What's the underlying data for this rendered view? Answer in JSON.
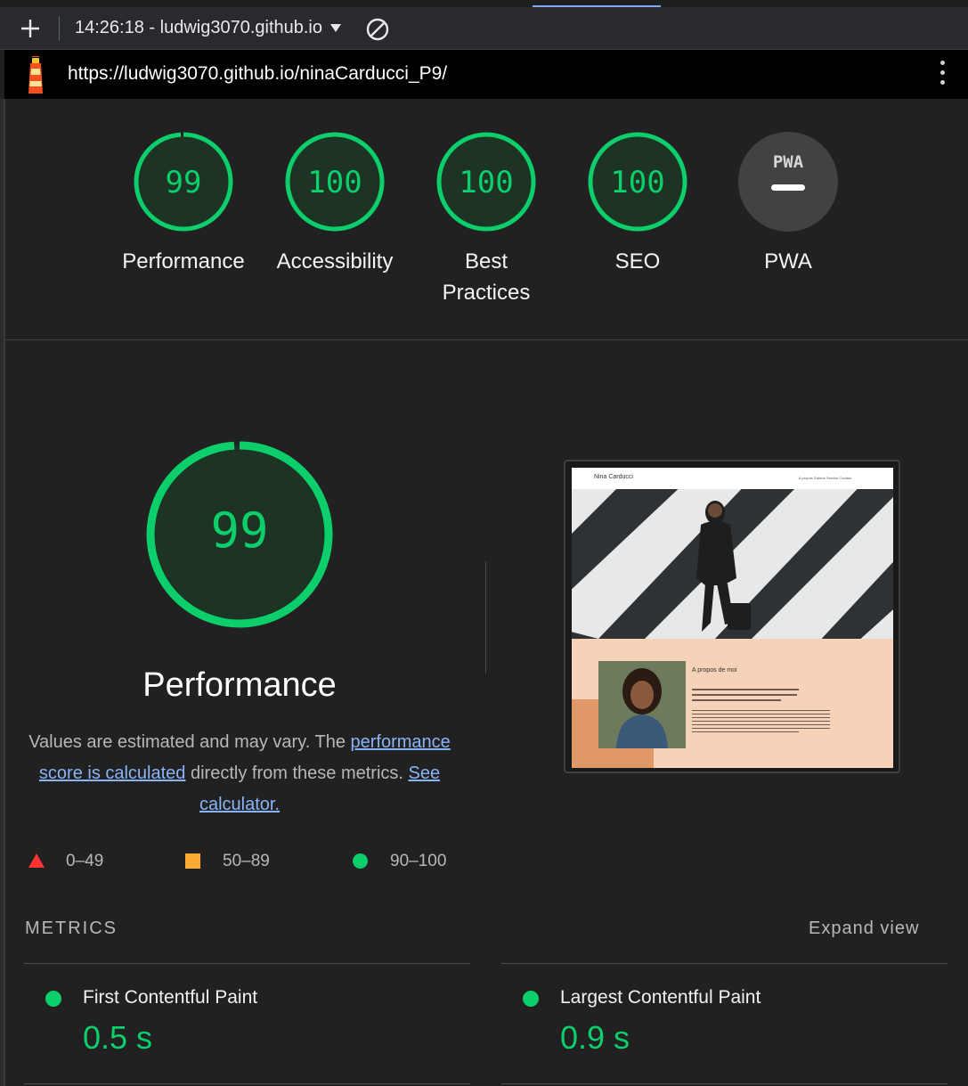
{
  "toolbar": {
    "report_label": "14:26:18 - ludwig3070.github.io",
    "new_report_icon": "plus-icon",
    "dropdown_icon": "caret-down-icon",
    "clear_icon": "block-icon"
  },
  "urlbar": {
    "url": "https://ludwig3070.github.io/ninaCarducci_P9/",
    "logo_icon": "lighthouse-icon",
    "menu_icon": "kebab-menu-icon"
  },
  "gauges": [
    {
      "score": "99",
      "value": 99,
      "label": "Performance"
    },
    {
      "score": "100",
      "value": 100,
      "label": "Accessibility"
    },
    {
      "score": "100",
      "value": 100,
      "label": "Best Practices"
    },
    {
      "score": "100",
      "value": 100,
      "label": "SEO"
    },
    {
      "score": "PWA",
      "value": null,
      "label": "PWA"
    }
  ],
  "performance": {
    "score": "99",
    "value": 99,
    "title": "Performance",
    "desc_prefix": "Values are estimated and may vary. The ",
    "desc_link": "performance score is calculated",
    "desc_mid": " directly from these metrics. ",
    "desc_link2": "See calculator."
  },
  "screenshot": {
    "brand": "Nina Carducci",
    "menu": "A propos   Galerie   Service   Contact",
    "about_title": "A propos de moi"
  },
  "legend": [
    {
      "range": "0–49",
      "shape": "triangle",
      "color": "#ff3333"
    },
    {
      "range": "50–89",
      "shape": "square",
      "color": "#ffaa33"
    },
    {
      "range": "90–100",
      "shape": "circle",
      "color": "#0cce6b"
    }
  ],
  "metrics": {
    "title": "METRICS",
    "expand_label": "Expand view",
    "items": [
      {
        "name": "First Contentful Paint",
        "value": "0.5 s"
      },
      {
        "name": "Largest Contentful Paint",
        "value": "0.9 s"
      }
    ]
  },
  "colors": {
    "pass": "#0cce6b",
    "pass_fill": "#1d3324",
    "background": "#212121",
    "link": "#8ab4f8"
  }
}
